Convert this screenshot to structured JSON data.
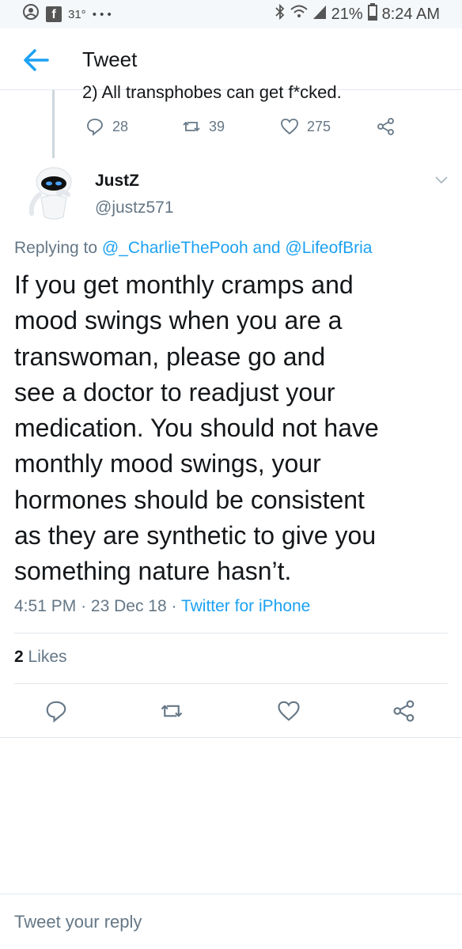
{
  "status_bar": {
    "temperature": "31°",
    "dots": "• • •",
    "battery_percent": "21%",
    "time": "8:24 AM"
  },
  "app_bar": {
    "title": "Tweet"
  },
  "previous_tweet": {
    "text": "2) All transphobes can get f*cked.",
    "reply_count": "28",
    "retweet_count": "39",
    "like_count": "275"
  },
  "tweet": {
    "display_name": "JustZ",
    "handle": "@justz571",
    "replying_prefix": "Replying to",
    "replying_user1": "@_CharlieThePooh",
    "replying_and": "and",
    "replying_user2": "@LifeofBria",
    "text": "If you get monthly cramps and\nmood swings when you are a\ntranswoman, please go and\nsee a doctor to readjust your\nmedication. You should not have\nmonthly mood swings, your\nhormones should be consistent\nas they are synthetic to give you\nsomething nature hasn’t.",
    "time": "4:51 PM",
    "sep": "·",
    "date": "23 Dec 18",
    "source": "Twitter for iPhone",
    "likes_count": "2",
    "likes_label": "Likes"
  },
  "reply_box": {
    "placeholder": "Tweet your reply"
  },
  "colors": {
    "accent": "#1da1f2",
    "secondary_text": "#657786",
    "divider": "#e1e8ed"
  }
}
